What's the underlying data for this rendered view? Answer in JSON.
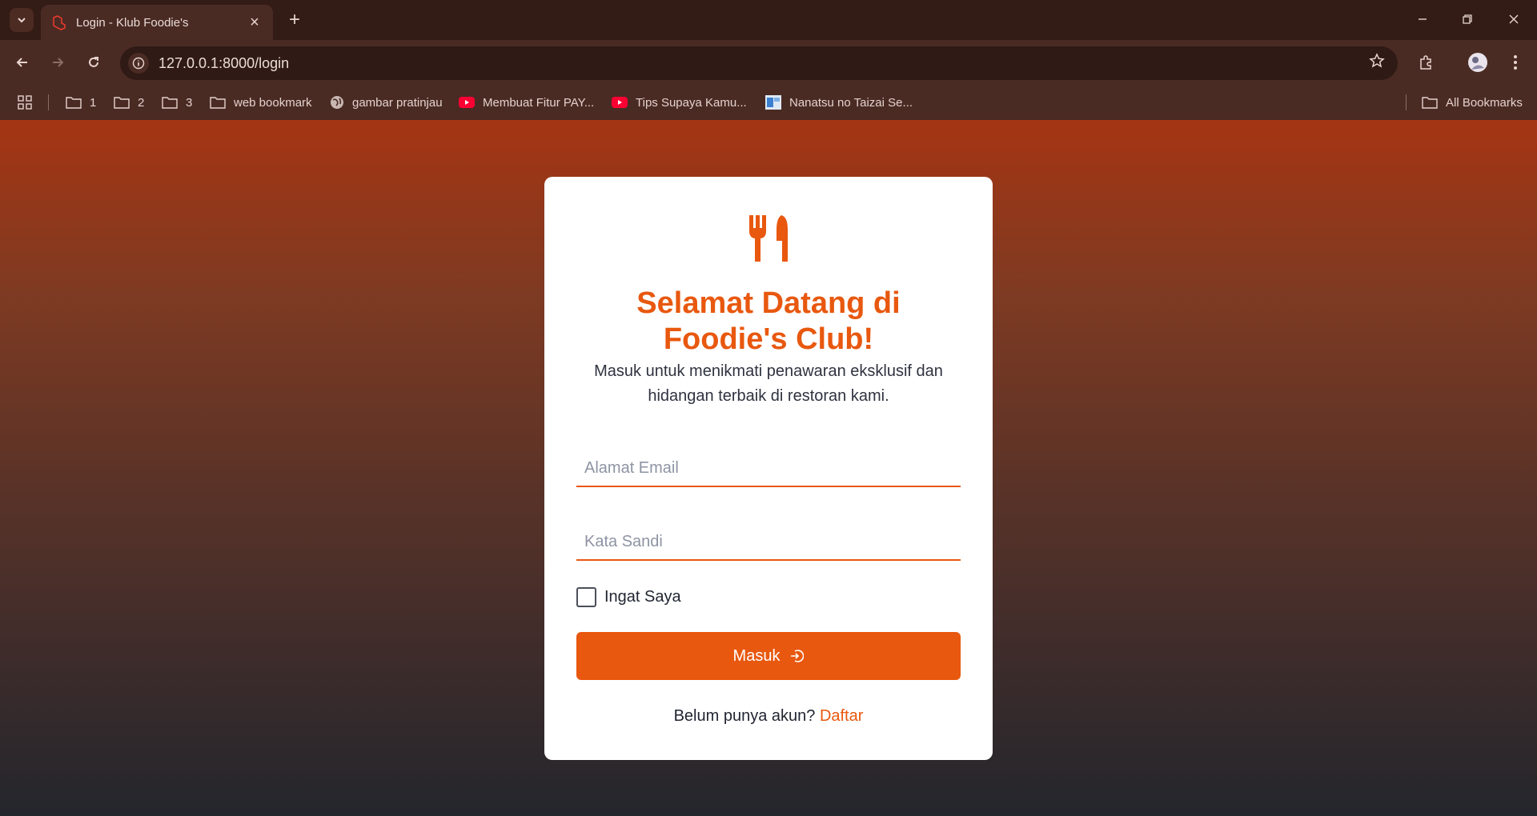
{
  "browser": {
    "tab_title": "Login - Klub Foodie's",
    "url": "127.0.0.1:8000/login",
    "bookmarks": [
      {
        "label": "1",
        "icon": "folder-icon"
      },
      {
        "label": "2",
        "icon": "folder-icon"
      },
      {
        "label": "3",
        "icon": "folder-icon"
      },
      {
        "label": "web bookmark",
        "icon": "folder-icon"
      },
      {
        "label": "gambar pratinjau",
        "icon": "globe-icon"
      },
      {
        "label": "Membuat Fitur PAY...",
        "icon": "youtube-icon"
      },
      {
        "label": "Tips Supaya Kamu...",
        "icon": "youtube-icon"
      },
      {
        "label": "Nanatsu no Taizai Se...",
        "icon": "site-icon"
      }
    ],
    "all_bookmarks_label": "All Bookmarks"
  },
  "login": {
    "title_line1": "Selamat Datang di",
    "title_line2": "Foodie's Club!",
    "subtitle": "Masuk untuk menikmati penawaran eksklusif dan hidangan terbaik di restoran kami.",
    "email_placeholder": "Alamat Email",
    "password_placeholder": "Kata Sandi",
    "remember_label": "Ingat Saya",
    "submit_label": "Masuk",
    "register_prompt": "Belum punya akun?",
    "register_link": "Daftar"
  },
  "colors": {
    "accent": "#e8580f",
    "card_bg": "#ffffff",
    "chrome_bg": "#4a2b24"
  }
}
